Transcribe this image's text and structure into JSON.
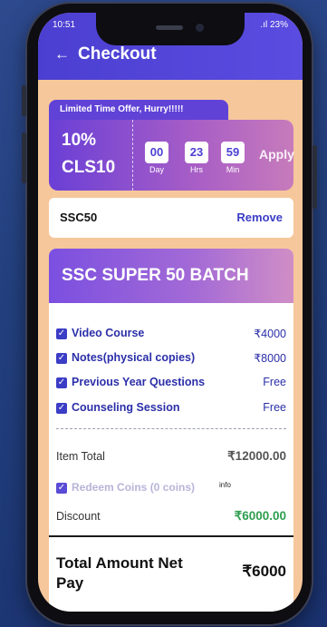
{
  "status_bar": {
    "time": "10:51",
    "right": ".ıl 23%"
  },
  "header": {
    "back_icon": "←",
    "title": "Checkout"
  },
  "offer": {
    "tag": "Limited Time Offer, Hurry!!!!!",
    "discount": "10%",
    "code": "CLS10",
    "timer": [
      {
        "value": "00",
        "label": "Day"
      },
      {
        "value": "23",
        "label": "Hrs"
      },
      {
        "value": "59",
        "label": "Min"
      }
    ],
    "apply_label": "Apply"
  },
  "coupon": {
    "code": "SSC50",
    "remove_label": "Remove"
  },
  "batch": {
    "title": "SSC SUPER 50 BATCH",
    "features": [
      {
        "name": "Video Course",
        "price": "₹4000"
      },
      {
        "name": "Notes(physical copies)",
        "price": "₹8000"
      },
      {
        "name": "Previous Year Questions",
        "price": "Free"
      },
      {
        "name": "Counseling Session",
        "price": "Free"
      }
    ],
    "item_total_label": "Item Total",
    "item_total_value": "₹12000.00",
    "redeem_label": "Redeem Coins (0 coins)",
    "redeem_info": "info",
    "discount_label": "Discount",
    "discount_value": "₹6000.00",
    "total_label": "Total Amount Net Pay",
    "total_value": "₹6000"
  },
  "colors": {
    "accent": "#4b3fd1",
    "background": "#f6c79b",
    "discount_green": "#2e9e4f",
    "feature_text": "#2b2fa8"
  }
}
